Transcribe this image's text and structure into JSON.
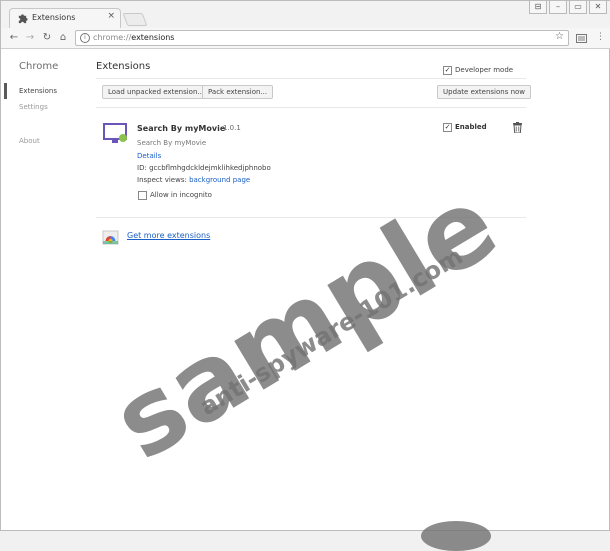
{
  "window": {
    "tab_title": "Extensions",
    "tab_close": "×",
    "controls": [
      "⊟",
      "–",
      "▭",
      "✕"
    ]
  },
  "toolbar": {
    "back": "←",
    "forward": "→",
    "reload": "↻",
    "home": "⌂",
    "url_scheme": "chrome://",
    "url_path": "extensions",
    "star": "☆",
    "menu": "⋮"
  },
  "sidebar": {
    "title": "Chrome",
    "items": [
      {
        "label": "Extensions"
      },
      {
        "label": "Settings"
      },
      {
        "label": "About"
      }
    ]
  },
  "main": {
    "title": "Extensions",
    "developer_mode_label": "Developer mode",
    "developer_mode_checked": true,
    "buttons": {
      "load_unpacked": "Load unpacked extension...",
      "pack": "Pack extension...",
      "update": "Update extensions now"
    }
  },
  "extension": {
    "name": "Search By myMovie",
    "version": "1.0.1",
    "description": "Search By myMovie",
    "details_link": "Details",
    "id_label": "ID:",
    "id_value": "gccbflmhgdckldejmklihkedjphnobo",
    "inspect_label": "Inspect views:",
    "inspect_link": "background page",
    "incognito_label": "Allow in incognito",
    "enabled_label": "Enabled",
    "enabled_checked": true
  },
  "footer": {
    "get_more": "Get more extensions"
  },
  "watermark": {
    "main": "sample",
    "site": "anti-spyware-101.com"
  }
}
